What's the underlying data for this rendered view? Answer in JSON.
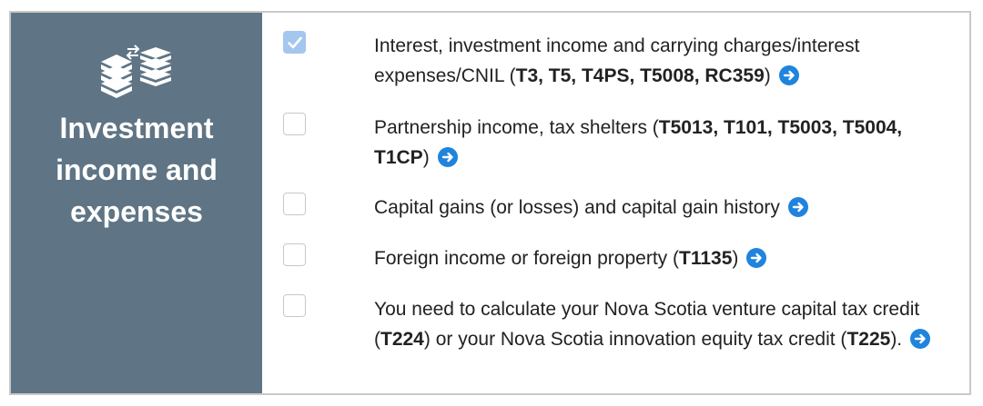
{
  "section": {
    "title_lines": [
      "Investment",
      "income and",
      "expenses"
    ]
  },
  "items": [
    {
      "checked": true,
      "parts": [
        "Interest, investment income and carrying charges/interest expenses/CNIL (",
        "T3, T5, T4PS, T5008, RC359",
        ")"
      ]
    },
    {
      "checked": false,
      "parts": [
        "Partnership income, tax shelters (",
        "T5013, T101, T5003, T5004, T1CP",
        ")"
      ]
    },
    {
      "checked": false,
      "parts": [
        "Capital gains (or losses) and capital gain history"
      ]
    },
    {
      "checked": false,
      "parts": [
        "Foreign income or foreign property (",
        "T1135",
        ")"
      ]
    },
    {
      "checked": false,
      "parts": [
        "You need to calculate your Nova Scotia venture capital tax credit (",
        "T224",
        ") or your Nova Scotia innovation equity tax credit (",
        "T225",
        ")."
      ]
    }
  ],
  "icons": {
    "section": "investment-documents-icon",
    "checkbox": "checkmark-icon",
    "more_info": "arrow-right-circle-icon"
  },
  "colors": {
    "sidebar": "#5f7585",
    "checkbox_checked": "#a3c7ee",
    "arrow": "#1f84dd"
  }
}
